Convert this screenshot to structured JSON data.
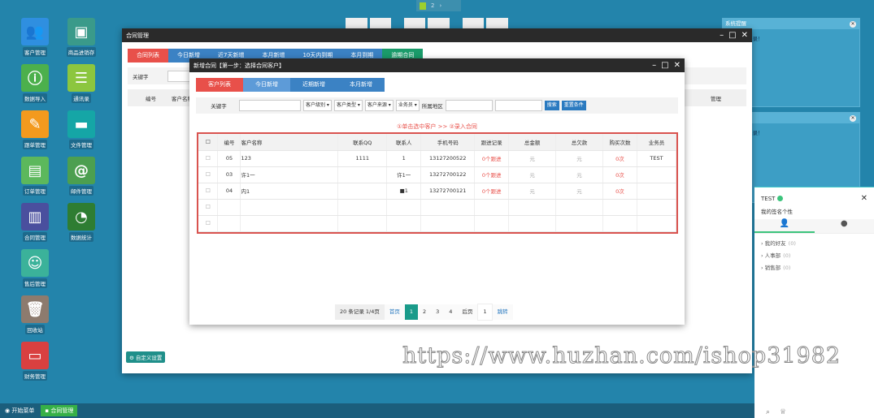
{
  "desktop_icons": [
    {
      "label": "客户管理",
      "color": "#2f8fe0",
      "glyph": "👥"
    },
    {
      "label": "商品进销存",
      "color": "#3a9a8a",
      "glyph": "▣"
    },
    {
      "label": "数据导入",
      "color": "#4cb04c",
      "glyph": "ⓘ"
    },
    {
      "label": "通讯录",
      "color": "#8cc63f",
      "glyph": "☰"
    },
    {
      "label": "跟单管理",
      "color": "#f39a1e",
      "glyph": "✎"
    },
    {
      "label": "文件管理",
      "color": "#15a6a6",
      "glyph": "▬"
    },
    {
      "label": "订单管理",
      "color": "#5cb85c",
      "glyph": "▤"
    },
    {
      "label": "邮件管理",
      "color": "#4c9f50",
      "glyph": "@"
    },
    {
      "label": "合同管理",
      "color": "#4a4f9e",
      "glyph": "▥"
    },
    {
      "label": "数据统计",
      "color": "#2e7d32",
      "glyph": "◔"
    },
    {
      "label": "售后管理",
      "color": "#3bb29a",
      "glyph": "☺"
    },
    {
      "label": "回收站",
      "color": "#8d7b6e",
      "glyph": "🗑"
    },
    {
      "label": "财务管理",
      "color": "#d94040",
      "glyph": "▭"
    }
  ],
  "top_pager": [
    "1",
    "2",
    "›"
  ],
  "back_window": {
    "title": "合同管理",
    "tabs": [
      "合同列表",
      "今日新增",
      "近7天新增",
      "本月新增",
      "10天内到期",
      "本月到期",
      "逾期合同"
    ],
    "keyword_label": "关键字",
    "columns": [
      "编号",
      "客户名称",
      "管理"
    ],
    "custom_button": "自定义设置"
  },
  "dialog": {
    "title": "新增合同【第一步：选择合同客户】",
    "tabs": [
      "客户列表",
      "今日新增",
      "近期新增",
      "本月新增"
    ],
    "filter": {
      "keyword_label": "关键字",
      "selects": [
        "客户级别",
        "客户类型",
        "客户来源",
        "业务员"
      ],
      "region_label": "所属地区",
      "search": "搜索",
      "reset": "重置条件"
    },
    "hint": "①单击选中客户 >> ②录入合同",
    "columns": [
      "编号",
      "客户名称",
      "联系QQ",
      "联系人",
      "手机号码",
      "跟进记录",
      "总金额",
      "总欠款",
      "购买次数",
      "业务员"
    ],
    "rows": [
      [
        "05",
        "123",
        "1111",
        "1",
        "13127200522",
        "0个跟进",
        "元",
        "元",
        "0次",
        "TEST"
      ],
      [
        "03",
        "许1一",
        "",
        "许1一",
        "13272700122",
        "0个跟进",
        "元",
        "元",
        "0次",
        ""
      ],
      [
        "04",
        "内1",
        "",
        "■1",
        "13272700121",
        "0个跟进",
        "元",
        "元",
        "0次",
        ""
      ],
      [
        "",
        "",
        "",
        "",
        "",
        "",
        "",
        "",
        "",
        ""
      ],
      [
        "",
        "",
        "",
        "",
        "",
        "",
        "",
        "",
        "",
        ""
      ]
    ],
    "pagination": {
      "summary": "20 条记录 1/4页",
      "first": "首页",
      "pages": [
        "1",
        "2",
        "3",
        "4"
      ],
      "next": "后页",
      "jump_value": "1",
      "jump": "跳转",
      "current": "1"
    }
  },
  "reminders": [
    {
      "title": "系统提醒",
      "text": "暂无未读记录！"
    },
    {
      "title": "系统提醒",
      "text": "暂无未读记录！"
    }
  ],
  "chat": {
    "user": "TEST",
    "status_color": "#3cc47c",
    "signature": "我的签名个性",
    "groups": [
      {
        "name": "我的好友",
        "count": "(0)"
      },
      {
        "name": "人事部",
        "count": "(0)"
      },
      {
        "name": "销售部",
        "count": "(0)"
      }
    ]
  },
  "taskbar": {
    "start": "开始菜单",
    "task": "合同管理"
  },
  "watermark": "https://www.huzhan.com/ishop31982"
}
